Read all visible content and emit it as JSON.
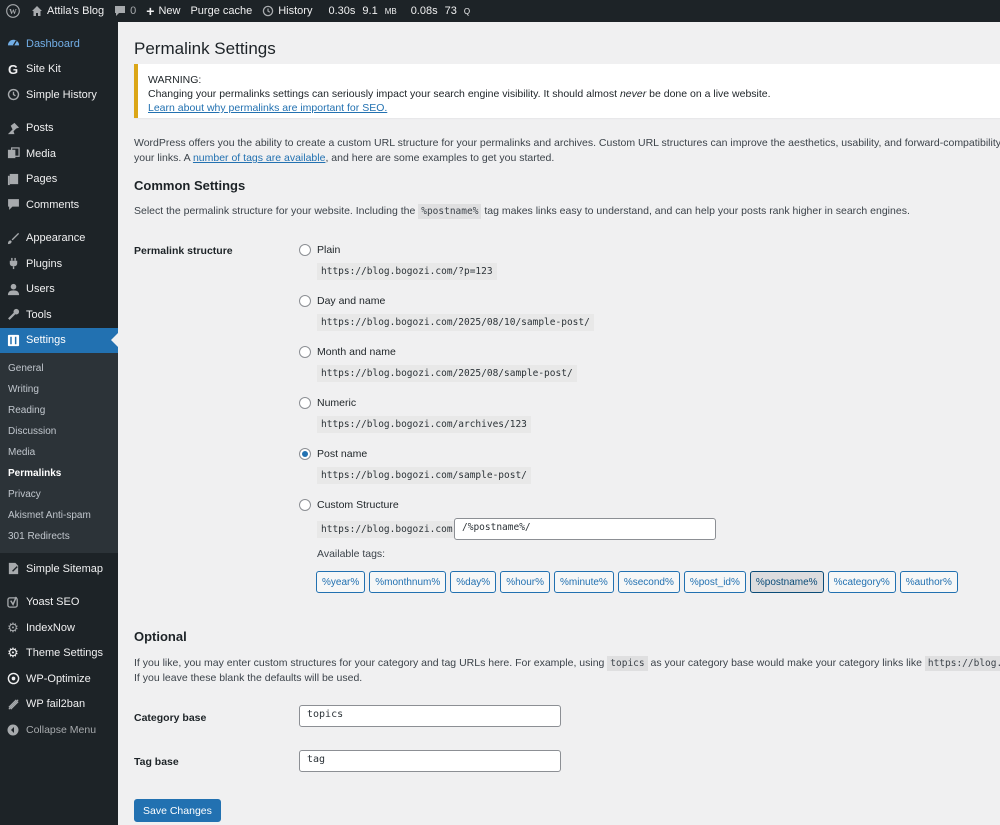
{
  "admin_bar": {
    "site_name": "Attila's Blog",
    "comments_count": "0",
    "new_label": "New",
    "purge_cache_label": "Purge cache",
    "history_label": "History",
    "stats": {
      "time": "0.30s",
      "memory_value": "9.1",
      "memory_unit": "MB",
      "db_time": "0.08s",
      "queries_value": "73",
      "queries_unit": "Q"
    }
  },
  "sidebar": {
    "items": [
      {
        "label": "Dashboard",
        "icon": "dashboard-icon"
      },
      {
        "label": "Site Kit",
        "icon": "google-g-icon"
      },
      {
        "label": "Simple History",
        "icon": "history-icon"
      },
      {
        "label": "Posts",
        "icon": "pin-icon"
      },
      {
        "label": "Media",
        "icon": "media-icon"
      },
      {
        "label": "Pages",
        "icon": "pages-icon"
      },
      {
        "label": "Comments",
        "icon": "comment-icon"
      },
      {
        "label": "Appearance",
        "icon": "brush-icon"
      },
      {
        "label": "Plugins",
        "icon": "plug-icon"
      },
      {
        "label": "Users",
        "icon": "user-icon"
      },
      {
        "label": "Tools",
        "icon": "wrench-icon"
      },
      {
        "label": "Settings",
        "icon": "settings-icon"
      },
      {
        "label": "Simple Sitemap",
        "icon": "sitemap-icon"
      },
      {
        "label": "Yoast SEO",
        "icon": "yoast-icon"
      },
      {
        "label": "IndexNow",
        "icon": "gear-icon"
      },
      {
        "label": "Theme Settings",
        "icon": "gear-icon"
      },
      {
        "label": "WP-Optimize",
        "icon": "optimize-icon"
      },
      {
        "label": "WP fail2ban",
        "icon": "ban-icon"
      }
    ],
    "settings_submenu": [
      "General",
      "Writing",
      "Reading",
      "Discussion",
      "Media",
      "Permalinks",
      "Privacy",
      "Akismet Anti-spam",
      "301 Redirects"
    ],
    "collapse_label": "Collapse Menu"
  },
  "page": {
    "title": "Permalink Settings",
    "warning": {
      "title": "WARNING:",
      "text_before": "Changing your permalinks settings can seriously impact your search engine visibility. It should almost ",
      "text_em": "never",
      "text_after": " be done on a live website.",
      "link": "Learn about why permalinks are important for SEO."
    },
    "intro": {
      "text": "WordPress offers you the ability to create a custom URL structure for your permalinks and archives. Custom URL structures can improve the aesthetics, usability, and forward-compatibility of your links. A ",
      "link1": "number of tags are available",
      "text2": ", and here are some examples to get you started."
    },
    "common": {
      "heading": "Common Settings",
      "desc_before": "Select the permalink structure for your website. Including the ",
      "desc_code": "%postname%",
      "desc_after": " tag makes links easy to understand, and can help your posts rank higher in search engines.",
      "field_label": "Permalink structure",
      "options": [
        {
          "label": "Plain",
          "example": "https://blog.bogozi.com/?p=123",
          "checked": false
        },
        {
          "label": "Day and name",
          "example": "https://blog.bogozi.com/2025/08/10/sample-post/",
          "checked": false
        },
        {
          "label": "Month and name",
          "example": "https://blog.bogozi.com/2025/08/sample-post/",
          "checked": false
        },
        {
          "label": "Numeric",
          "example": "https://blog.bogozi.com/archives/123",
          "checked": false
        },
        {
          "label": "Post name",
          "example": "https://blog.bogozi.com/sample-post/",
          "checked": true
        },
        {
          "label": "Custom Structure",
          "example": "https://blog.bogozi.com",
          "checked": false
        }
      ],
      "custom_value": "/%postname%/",
      "available_tags_label": "Available tags:",
      "tags": [
        "%year%",
        "%monthnum%",
        "%day%",
        "%hour%",
        "%minute%",
        "%second%",
        "%post_id%",
        "%postname%",
        "%category%",
        "%author%"
      ],
      "active_tag": "%postname%"
    },
    "optional": {
      "heading": "Optional",
      "desc_before": "If you like, you may enter custom structures for your category and tag URLs here. For example, using ",
      "desc_code1": "topics",
      "desc_middle": " as your category base would make your category links like ",
      "desc_code2": "https://blog.bogozi.com/topics/uncategorized/",
      "desc_line2": "If you leave these blank the defaults will be used.",
      "category_base_label": "Category base",
      "category_base_value": "topics",
      "tag_base_label": "Tag base",
      "tag_base_value": "tag"
    },
    "save_label": "Save Changes"
  },
  "colors": {
    "accent": "#2271b1",
    "sidebar_bg": "#1d2327",
    "warning_border": "#dba617"
  }
}
